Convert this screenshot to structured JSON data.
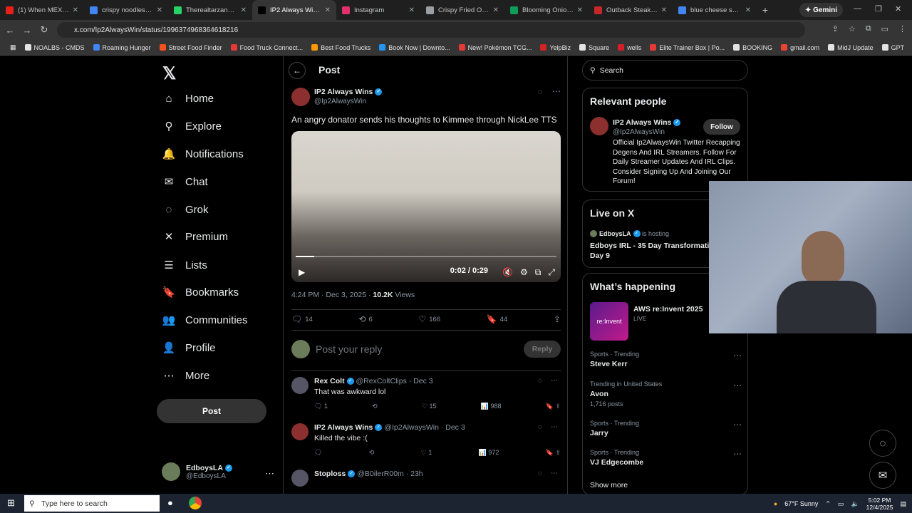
{
  "browser": {
    "tabs": [
      {
        "label": "(1) When MEXICAN...",
        "color": "#e62117",
        "active": false
      },
      {
        "label": "crispy noodles buli...",
        "color": "#4285f4",
        "active": false
      },
      {
        "label": "Therealtarzann Stre...",
        "color": "#25d366",
        "active": false
      },
      {
        "label": "IP2 Always Wins on...",
        "color": "#000000",
        "active": true
      },
      {
        "label": "Instagram",
        "color": "#e1306c",
        "active": false
      },
      {
        "label": "Crispy Fried Onions",
        "color": "#9aa0a6",
        "active": false
      },
      {
        "label": "Blooming Onion (Bl...",
        "color": "#0f9d58",
        "active": false
      },
      {
        "label": "Outback Steakhous...",
        "color": "#c62828",
        "active": false
      },
      {
        "label": "blue cheese salad",
        "color": "#4285f4",
        "active": false
      }
    ],
    "gemini_label": "Gemini",
    "url": "x.com/Ip2AlwaysWin/status/1996374968364618216",
    "bookmarks": [
      {
        "label": "NOALBS - CMDS",
        "color": "#e3e3e3"
      },
      {
        "label": "Roaming Hunger",
        "color": "#4285f4"
      },
      {
        "label": "Street Food Finder",
        "color": "#f4511e"
      },
      {
        "label": "Food Truck Connect...",
        "color": "#e53935"
      },
      {
        "label": "Best Food Trucks",
        "color": "#ff9800"
      },
      {
        "label": "Book Now | Downto...",
        "color": "#2196f3"
      },
      {
        "label": "New! Pokémon TCG...",
        "color": "#e53935"
      },
      {
        "label": "YelpBiz",
        "color": "#d32323"
      },
      {
        "label": "Square",
        "color": "#e3e3e3"
      },
      {
        "label": "wells",
        "color": "#d71e28"
      },
      {
        "label": "Elite Trainer Box | Po...",
        "color": "#e53935"
      },
      {
        "label": "BOOKING",
        "color": "#e3e3e3"
      },
      {
        "label": "gmail.com",
        "color": "#ea4335"
      },
      {
        "label": "MidJ Update",
        "color": "#e3e3e3"
      },
      {
        "label": "GPT",
        "color": "#e3e3e3"
      }
    ]
  },
  "sidebar": {
    "items": [
      {
        "label": "Home",
        "icon": "home-icon",
        "glyph": "⌂"
      },
      {
        "label": "Explore",
        "icon": "search-icon",
        "glyph": "⚲"
      },
      {
        "label": "Notifications",
        "icon": "bell-icon",
        "glyph": "🔔"
      },
      {
        "label": "Chat",
        "icon": "mail-icon",
        "glyph": "✉"
      },
      {
        "label": "Grok",
        "icon": "grok-icon",
        "glyph": "◌"
      },
      {
        "label": "Premium",
        "icon": "x-icon",
        "glyph": "✕"
      },
      {
        "label": "Lists",
        "icon": "list-icon",
        "glyph": "☰"
      },
      {
        "label": "Bookmarks",
        "icon": "bookmark-icon",
        "glyph": "🔖"
      },
      {
        "label": "Communities",
        "icon": "communities-icon",
        "glyph": "👥"
      },
      {
        "label": "Profile",
        "icon": "profile-icon",
        "glyph": "👤"
      },
      {
        "label": "More",
        "icon": "more-icon",
        "glyph": "⋯"
      }
    ],
    "post_label": "Post",
    "account": {
      "name": "EdboysLA",
      "handle": "@EdboysLA"
    }
  },
  "main": {
    "title": "Post",
    "author": {
      "name": "IP2 Always Wins",
      "handle": "@Ip2AlwaysWin"
    },
    "text": "An angry donator sends his thoughts to Kimmee through NickLee TTS",
    "video": {
      "time": "0:02 / 0:29",
      "progress": 0.07
    },
    "meta": {
      "time": "4:24 PM · Dec 3, 2025 · ",
      "views": "10.2K",
      "views_label": " Views"
    },
    "stats": {
      "replies": "14",
      "reposts": "6",
      "likes": "166",
      "bookmarks": "44"
    },
    "reply_placeholder": "Post your reply",
    "reply_button": "Reply",
    "comments": [
      {
        "name": "Rex Colt",
        "handle": "@RexColtClips · Dec 3",
        "text": "That was awkward lol",
        "replies": "1",
        "reposts": "",
        "likes": "15",
        "views": "988"
      },
      {
        "name": "IP2 Always Wins",
        "handle": "@Ip2AlwaysWin · Dec 3",
        "text": "Killed the vibe :(",
        "replies": "",
        "reposts": "",
        "likes": "1",
        "views": "972"
      },
      {
        "name": "Stoploss",
        "handle": "@B0ilerR00m · 23h",
        "text": "",
        "replies": "",
        "reposts": "",
        "likes": "",
        "views": ""
      }
    ]
  },
  "right": {
    "search_placeholder": "Search",
    "relevant": {
      "title": "Relevant people",
      "name": "IP2 Always Wins",
      "handle": "@Ip2AlwaysWin",
      "follow": "Follow",
      "bio": "Official Ip2AlwaysWin Twitter Recapping Degens And IRL Streamers. Follow For Daily Streamer Updates And IRL Clips. Consider Signing Up And Joining Our Forum!"
    },
    "live": {
      "title": "Live on X",
      "host": "EdboysLA",
      "hosting": "is hosting",
      "event": "Edboys IRL - 35 Day Transformatio",
      "day": "Day 9"
    },
    "happening": {
      "title": "What’s happening",
      "featured": {
        "name": "AWS re:Invent 2025",
        "status": "LIVE",
        "thumb": "re:Invent"
      },
      "trends": [
        {
          "cat": "Sports · Trending",
          "name": "Steve Kerr",
          "posts": ""
        },
        {
          "cat": "Trending in United States",
          "name": "Avon",
          "posts": "1,716 posts"
        },
        {
          "cat": "Sports · Trending",
          "name": "Jarry",
          "posts": ""
        },
        {
          "cat": "Sports · Trending",
          "name": "VJ Edgecombe",
          "posts": ""
        }
      ],
      "show_more": "Show more"
    }
  },
  "taskbar": {
    "search_placeholder": "Type here to search",
    "weather": "67°F  Sunny",
    "time": "5:02 PM",
    "date": "12/4/2025"
  }
}
